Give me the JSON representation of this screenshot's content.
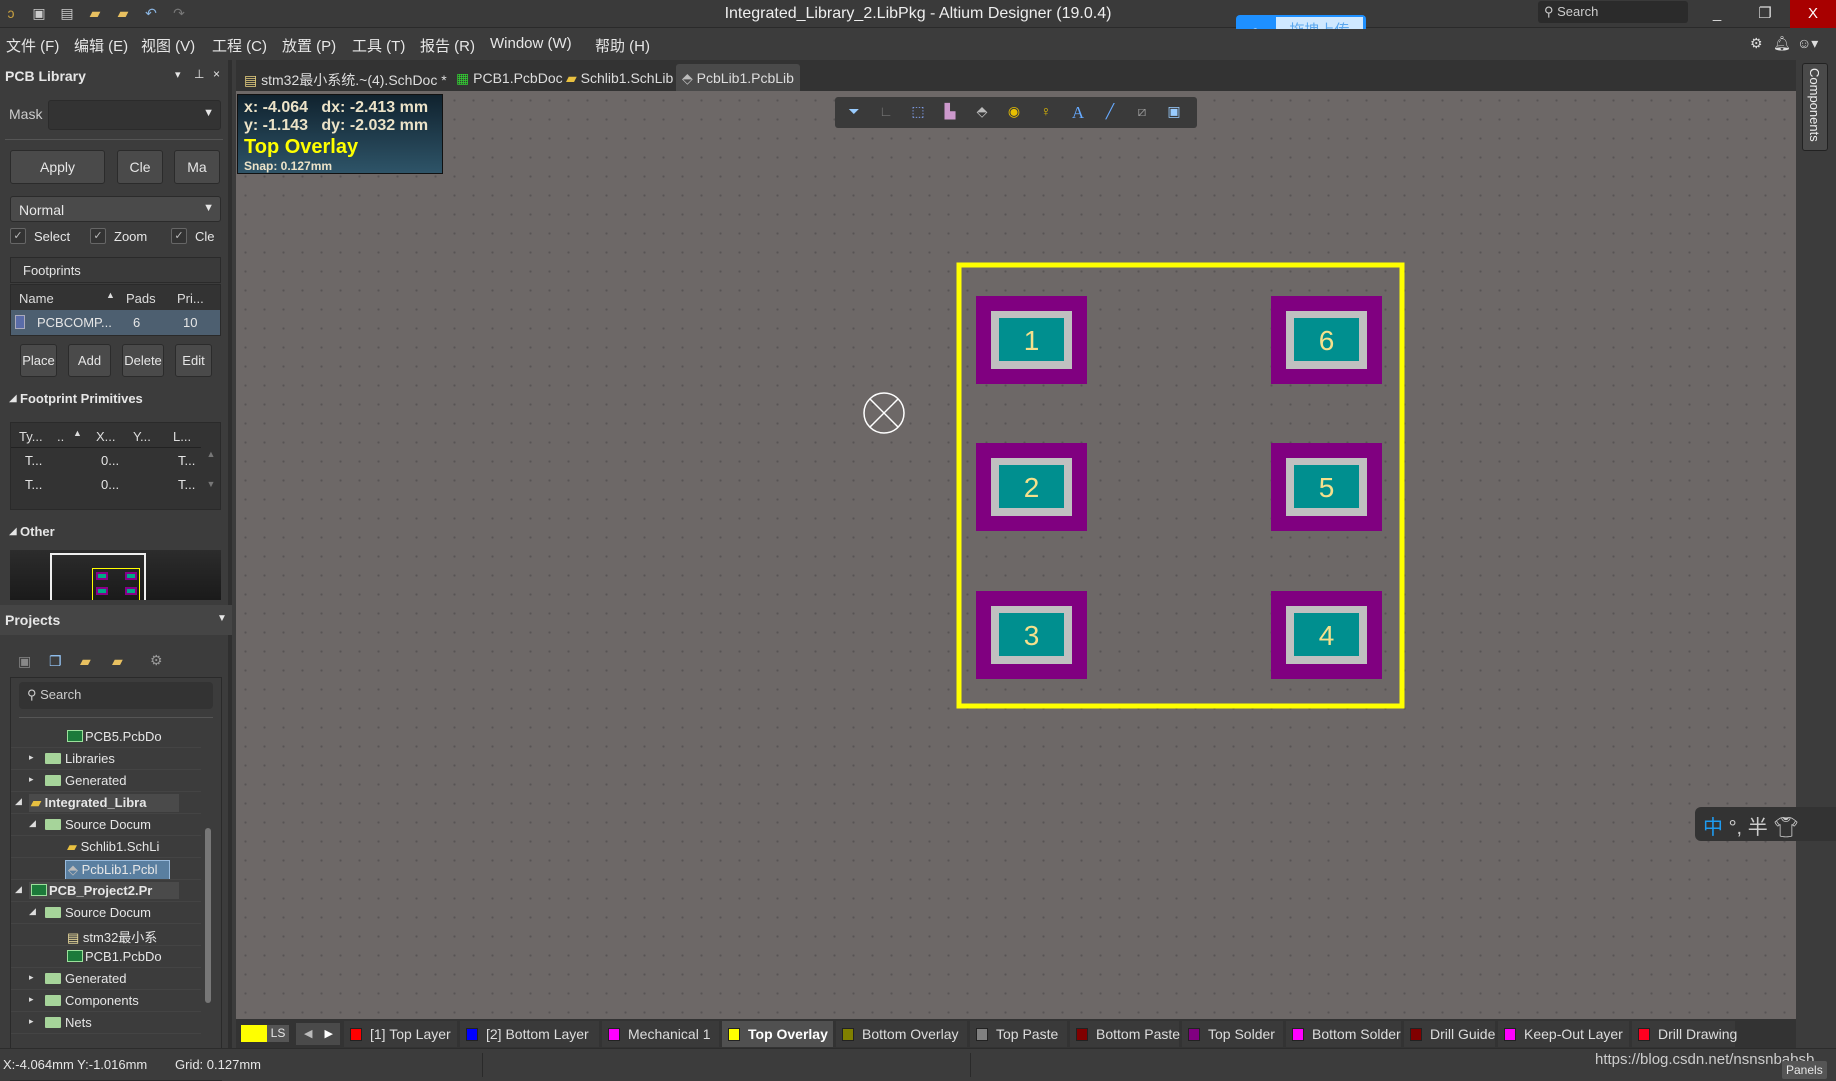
{
  "window": {
    "title": "Integrated_Library_2.LibPkg - Altium Designer (19.0.4)",
    "search_placeholder": "Search",
    "minimize": "_",
    "restore": "❐",
    "close": "X"
  },
  "upload_widget": {
    "label": "拖拽上传"
  },
  "menu": [
    "文件 (F)",
    "编辑 (E)",
    "视图 (V)",
    "工程 (C)",
    "放置 (P)",
    "工具 (T)",
    "报告 (R)",
    "Window (W)",
    "帮助 (H)"
  ],
  "pcb_library": {
    "title": "PCB Library",
    "mask_label": "Mask",
    "mask_value": "",
    "apply": "Apply",
    "clear": "Cle",
    "magnify": "Ma",
    "mode": "Normal",
    "checks": [
      {
        "label": "Select",
        "checked": true
      },
      {
        "label": "Zoom",
        "checked": true
      },
      {
        "label": "Cle",
        "checked": true
      }
    ],
    "footprints_label": "Footprints",
    "columns": [
      "Name",
      "Pads",
      "Pri..."
    ],
    "rows": [
      {
        "name": "PCBCOMP...",
        "pads": "6",
        "primitives": "10"
      }
    ],
    "place": "Place",
    "add": "Add",
    "delete": "Delete",
    "edit": "Edit",
    "primitives_label": "Footprint Primitives",
    "prim_columns": [
      "Ty...",
      "..",
      "X...",
      "Y...",
      "L..."
    ],
    "prim_rows": [
      [
        "T...",
        "",
        "0...",
        "",
        "T..."
      ],
      [
        "T...",
        "",
        "0...",
        "",
        "T..."
      ]
    ],
    "other_label": "Other"
  },
  "projects": {
    "title": "Projects",
    "search_placeholder": "Search",
    "tree": [
      {
        "label": "PCB5.PcbDo",
        "level": 2,
        "icon": "pcb"
      },
      {
        "label": "Libraries",
        "level": 1,
        "icon": "folder",
        "toggle": "▸"
      },
      {
        "label": "Generated",
        "level": 1,
        "icon": "folder",
        "toggle": "▸"
      },
      {
        "label": "Integrated_Libra",
        "level": 0,
        "icon": "intlib",
        "toggle": "◢",
        "bold": true
      },
      {
        "label": "Source Docum",
        "level": 1,
        "icon": "folder",
        "toggle": "◢"
      },
      {
        "label": "Schlib1.SchLi",
        "level": 2,
        "icon": "schlib"
      },
      {
        "label": "PcbLib1.Pcbl",
        "level": 2,
        "icon": "pcblib",
        "selected": true
      },
      {
        "label": "PCB_Project2.Pr",
        "level": 0,
        "icon": "pcbproj",
        "toggle": "◢",
        "bold": true
      },
      {
        "label": "Source Docum",
        "level": 1,
        "icon": "folder",
        "toggle": "◢"
      },
      {
        "label": "stm32最小系",
        "level": 2,
        "icon": "sch"
      },
      {
        "label": "PCB1.PcbDo",
        "level": 2,
        "icon": "pcb"
      },
      {
        "label": "Generated",
        "level": 1,
        "icon": "folder",
        "toggle": "▸"
      },
      {
        "label": "Components",
        "level": 1,
        "icon": "folder",
        "toggle": "▸"
      },
      {
        "label": "Nets",
        "level": 1,
        "icon": "folder",
        "toggle": "▸"
      }
    ]
  },
  "tabs": [
    {
      "label": "stm32最小系统.~(4).SchDoc *"
    },
    {
      "label": "PCB1.PcbDoc"
    },
    {
      "label": "Schlib1.SchLib"
    },
    {
      "label": "PcbLib1.PcbLib",
      "active": true
    }
  ],
  "coords": {
    "line1": "x: -4.064   dx: -2.413 mm",
    "line2": "y: -1.143   dy: -2.032 mm",
    "layer": "Top Overlay",
    "snap": "Snap: 0.127mm"
  },
  "footprint": {
    "pads": [
      "1",
      "2",
      "3",
      "4",
      "5",
      "6"
    ],
    "colors": {
      "overlay": "#ffff00",
      "solder_mask": "#800080",
      "paste": "#c0c0c0",
      "copper": "#008f8f",
      "pad_text": "#f5e08c"
    }
  },
  "right_panel": {
    "components_tab": "Components"
  },
  "ime": {
    "lang": "中",
    "punct": "°,",
    "width": "半"
  },
  "layers": {
    "ls": "LS",
    "items": [
      {
        "label": "[1] Top Layer",
        "color": "#ff0000"
      },
      {
        "label": "[2] Bottom Layer",
        "color": "#0000ff"
      },
      {
        "label": "Mechanical 1",
        "color": "#ff00ff"
      },
      {
        "label": "Top Overlay",
        "color": "#ffff00",
        "active": true
      },
      {
        "label": "Bottom Overlay",
        "color": "#808000"
      },
      {
        "label": "Top Paste",
        "color": "#808080"
      },
      {
        "label": "Bottom Paste",
        "color": "#800000"
      },
      {
        "label": "Top Solder",
        "color": "#800080"
      },
      {
        "label": "Bottom Solder",
        "color": "#ff00ff"
      },
      {
        "label": "Drill Guide",
        "color": "#800000"
      },
      {
        "label": "Keep-Out Layer",
        "color": "#ff00ff"
      },
      {
        "label": "Drill Drawing",
        "color": "#ff0020"
      }
    ]
  },
  "status": {
    "position": "X:-4.064mm Y:-1.016mm",
    "grid": "Grid: 0.127mm",
    "watermark": "https://blog.csdn.net/nsnsnbabsb",
    "panels": "Panels"
  }
}
